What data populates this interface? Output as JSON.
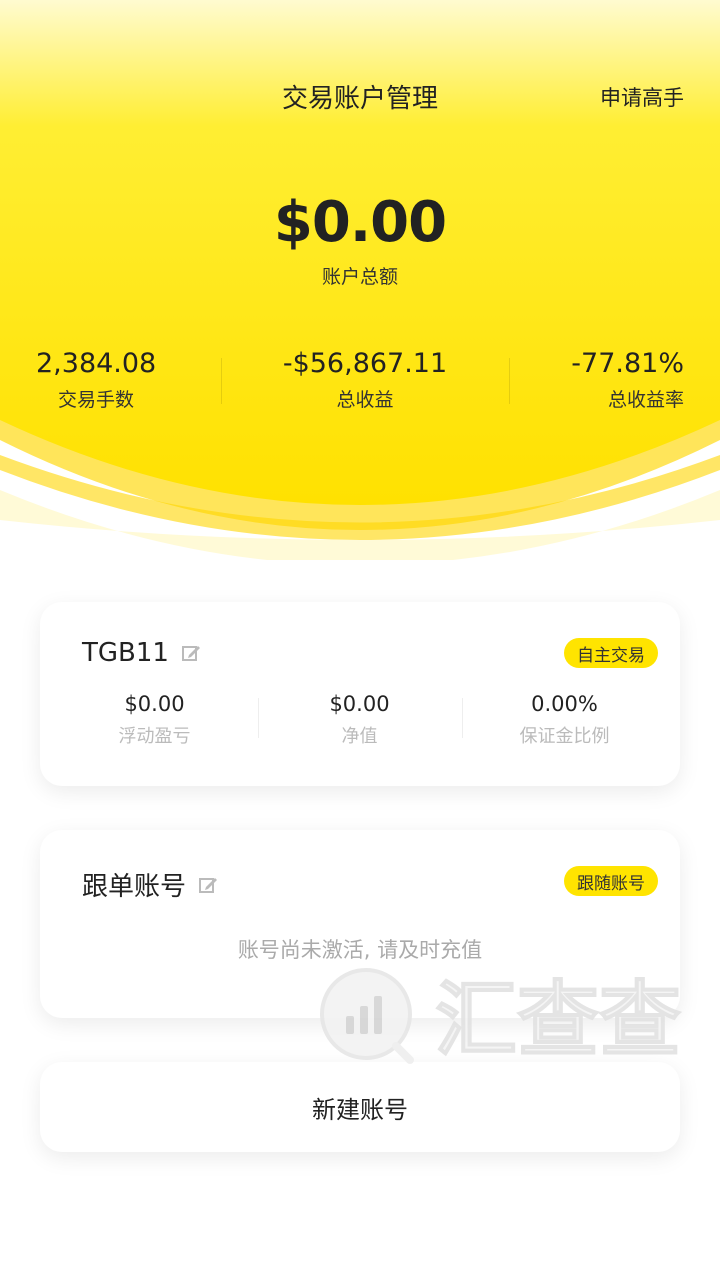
{
  "header": {
    "title": "交易账户管理",
    "right_link": "申请高手",
    "total_amount": "$0.00",
    "total_label": "账户总额"
  },
  "stats": [
    {
      "value": "2,384.08",
      "label": "交易手数"
    },
    {
      "value": "-$56,867.11",
      "label": "总收益"
    },
    {
      "value": "-77.81%",
      "label": "总收益率"
    }
  ],
  "accounts": [
    {
      "name": "TGB11",
      "badge": "自主交易",
      "metrics": [
        {
          "value": "$0.00",
          "label": "浮动盈亏"
        },
        {
          "value": "$0.00",
          "label": "净值"
        },
        {
          "value": "0.00%",
          "label": "保证金比例"
        }
      ]
    },
    {
      "name": "跟单账号",
      "badge": "跟随账号",
      "message": "账号尚未激活, 请及时充值"
    }
  ],
  "new_account_label": "新建账号",
  "watermark": {
    "text": "汇查查"
  },
  "colors": {
    "brand_yellow": "#ffe400",
    "header_light": "#fff7a8",
    "edit_icon": "#bbbbbb"
  }
}
